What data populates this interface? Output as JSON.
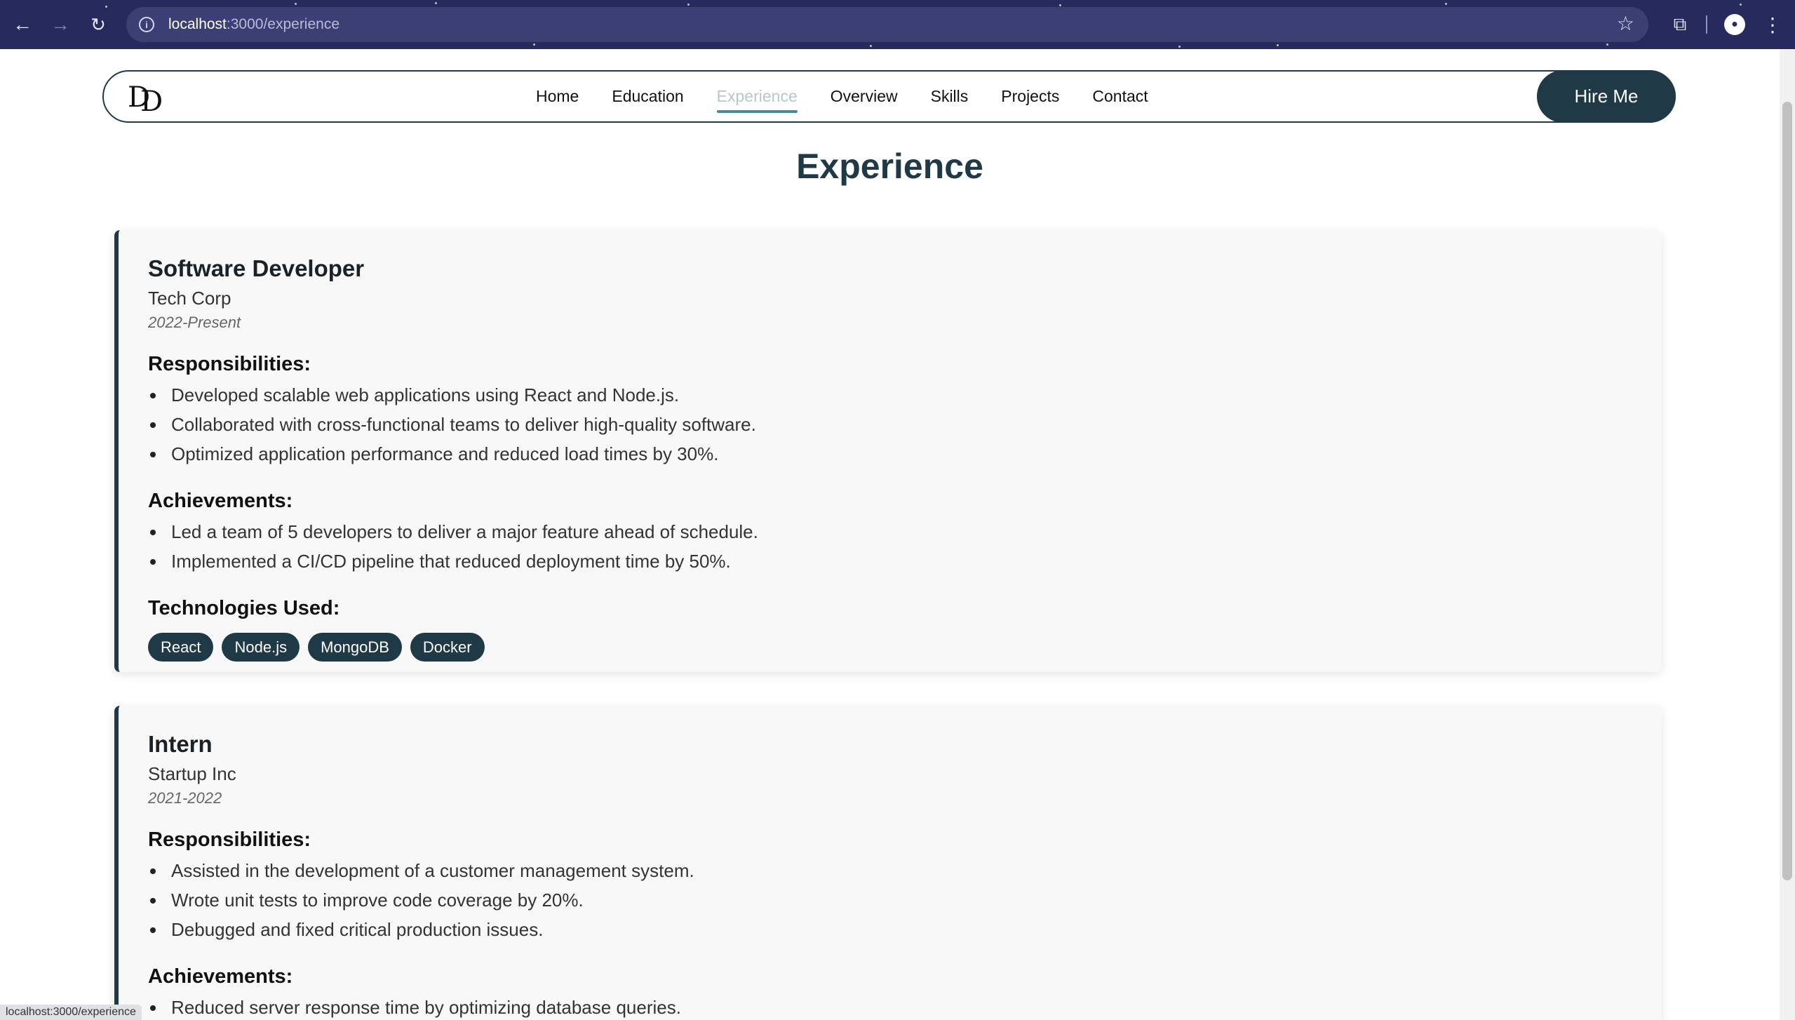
{
  "browser": {
    "url_host": "localhost",
    "url_path": ":3000/experience",
    "status_text": "localhost:3000/experience",
    "icons": {
      "back": "arrow-left-icon",
      "forward": "arrow-right-icon",
      "reload": "reload-icon",
      "site_info": "info-icon",
      "bookmark": "star-icon",
      "extensions": "puzzle-icon",
      "profile": "profile-icon",
      "menu": "kebab-menu-icon"
    }
  },
  "site_nav": {
    "links": [
      "Home",
      "Education",
      "Experience",
      "Overview",
      "Skills",
      "Projects",
      "Contact"
    ],
    "active": "Experience",
    "cta": "Hire Me"
  },
  "page": {
    "title": "Experience"
  },
  "experiences": [
    {
      "title": "Software Developer",
      "company": "Tech Corp",
      "period": "2022-Present",
      "responsibilities_heading": "Responsibilities:",
      "responsibilities": [
        "Developed scalable web applications using React and Node.js.",
        "Collaborated with cross-functional teams to deliver high-quality software.",
        "Optimized application performance and reduced load times by 30%."
      ],
      "achievements_heading": "Achievements:",
      "achievements": [
        "Led a team of 5 developers to deliver a major feature ahead of schedule.",
        "Implemented a CI/CD pipeline that reduced deployment time by 50%."
      ],
      "technologies_heading": "Technologies Used:",
      "technologies": [
        "React",
        "Node.js",
        "MongoDB",
        "Docker"
      ]
    },
    {
      "title": "Intern",
      "company": "Startup Inc",
      "period": "2021-2022",
      "responsibilities_heading": "Responsibilities:",
      "responsibilities": [
        "Assisted in the development of a customer management system.",
        "Wrote unit tests to improve code coverage by 20%.",
        "Debugged and fixed critical production issues."
      ],
      "achievements_heading": "Achievements:",
      "achievements": [
        "Reduced server response time by optimizing database queries."
      ]
    }
  ],
  "colors": {
    "brand": "#1f3a46",
    "active_underline": "#4a8aa0",
    "chrome_bg": "#262a5c"
  }
}
